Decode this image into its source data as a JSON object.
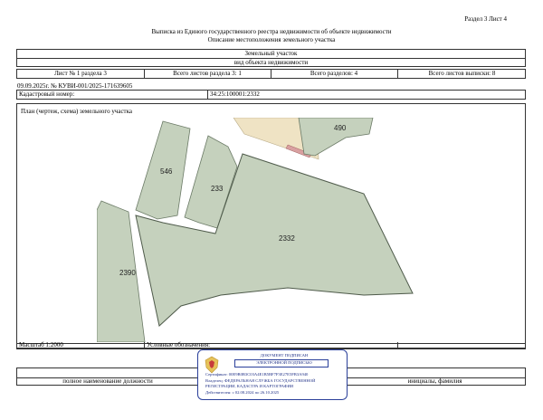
{
  "header": {
    "section_ref": "Раздел 3   Лист 4",
    "title": "Выписка из Единого государственного реестра недвижимости об объекте недвижимости",
    "subtitle": "Описание местоположения земельного участка"
  },
  "object": {
    "type": "Земельный участок",
    "type_caption": "вид объекта недвижимости"
  },
  "sheet_row": {
    "sheet": "Лист № 1 раздела 3",
    "sheets_in_section": "Всего листов раздела 3: 1",
    "sections": "Всего разделов: 4",
    "sheets_total": "Всего листов выписки: 8"
  },
  "record": {
    "doc_number": "09.09.2025г. № КУВИ-001/2025-171639605",
    "cadastral_label": "Кадастровый номер:",
    "cadastral_number": "34:25:100001:2332"
  },
  "plan": {
    "caption": "План (чертеж, схема) земельного участка",
    "parcels": {
      "main": "2332",
      "p546": "546",
      "p2390": "2390",
      "p490": "490",
      "p233": "233"
    }
  },
  "footer": {
    "scale": "Масштаб 1:2000",
    "legend_label": "Условные обозначения:",
    "position_caption": "полное наименование должности",
    "name_caption": "инициалы, фамилия"
  },
  "stamp": {
    "title": "ДОКУМЕНТ ПОДПИСАН",
    "subtitle": "ЭЛЕКТРОННОЙ ПОДПИСЬЮ",
    "certificate": "Сертификат: 00E9B0B3C03A4E1B5BF7F3E27E5FB3A940",
    "owner_line1": "Владелец: ФЕДЕРАЛЬНАЯ СЛУЖБА ГОСУДАРСТВЕННОЙ",
    "owner_line2": "РЕГИСТРАЦИИ, КАДАСТРА И КАРТОГРАФИИ",
    "validity": "Действителен: с 02.08.2024 по 26.10.2025"
  },
  "colors": {
    "parcel_fill": "#c5d1bd",
    "parcel_stroke": "#6b7a66",
    "road_fill": "#efe3c4",
    "stamp_blue": "#2a3f9a"
  }
}
